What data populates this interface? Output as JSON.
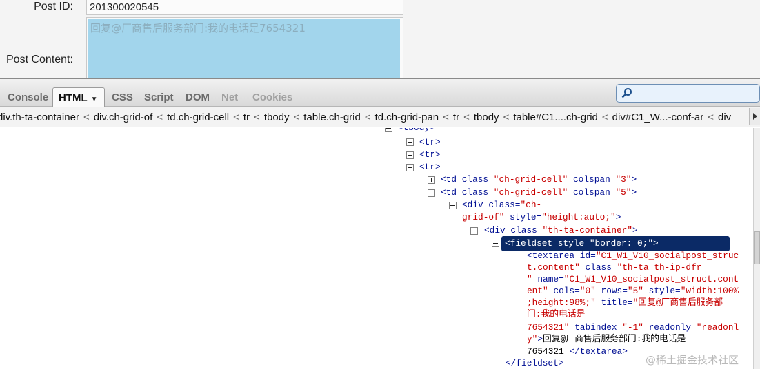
{
  "form": {
    "post_id_label": "Post ID:",
    "post_id_value": "201300020545",
    "post_content_label": "Post Content:",
    "post_content_value": "回复@厂商售后服务部门:我的电话是7654321"
  },
  "toolbar": {
    "tabs": [
      "Console",
      "HTML",
      "CSS",
      "Script",
      "DOM",
      "Net",
      "Cookies"
    ],
    "active_tab": "HTML",
    "search_value": ""
  },
  "breadcrumb": [
    "div.th-ta-container",
    "div.ch-grid-of",
    "td.ch-grid-cell",
    "tr",
    "tbody",
    "table.ch-grid",
    "td.ch-grid-pan",
    "tr",
    "tbody",
    "table#C1....ch-grid",
    "div#C1_W...-conf-ar",
    "div"
  ],
  "breadcrumb_sep": "<",
  "tree": {
    "tbody": "<tbody>",
    "tr1": "<tr>",
    "tr2": "<tr>",
    "tr3": "<tr>",
    "td1": {
      "open": "<td ",
      "a1": "class=",
      "v1": "\"ch-grid-cell\"",
      "a2": " colspan=",
      "v2": "\"3\"",
      "close": ">"
    },
    "td2": {
      "open": "<td ",
      "a1": "class=",
      "v1": "\"ch-grid-cell\"",
      "a2": " colspan=",
      "v2": "\"5\"",
      "close": ">"
    },
    "div1_l1": {
      "open": "<div ",
      "a1": "class=",
      "v1": "\"ch-"
    },
    "div1_l2": {
      "v1": "grid-of\"",
      "a2": " style=",
      "v2": "\"height:auto;\"",
      "close": ">"
    },
    "div2": {
      "open": "<div ",
      "a1": "class=",
      "v1": "\"th-ta-container\"",
      "close": ">"
    },
    "fieldset": "<fieldset style=\"border: 0;\">",
    "ta_l1": {
      "open": "<textarea ",
      "a1": "id=",
      "v1": "\"C1_W1_V10_socialpost_struc"
    },
    "ta_l2": {
      "v1": "t.content\"",
      "a2": " class=",
      "v2": "\"th-ta th-ip-dfr"
    },
    "ta_l3": {
      "v1": "\"",
      "a3": " name=",
      "v3": "\"C1_W1_V10_socialpost_struct.cont"
    },
    "ta_l4": {
      "v3": "ent\"",
      "a4": " cols=",
      "v4": "\"0\"",
      "a5": " rows=",
      "v5": "\"5\"",
      "a6": " style=",
      "v6": "\"width:100%"
    },
    "ta_l5": {
      "v6": ";height:98%;\"",
      "a7": " title=",
      "v7": "\"回复@厂商售后服务部"
    },
    "ta_l6": {
      "v7": "门:我的电话是"
    },
    "ta_l7": {
      "v7": "7654321\"",
      "a8": " tabindex=",
      "v8": "\"-1\"",
      "a9": " readonly=",
      "v9": "\"readonl"
    },
    "ta_l8": {
      "v9": "y\"",
      "close": ">",
      "text": "回复@厂商售后服务部门:我的电话是"
    },
    "ta_l9": {
      "text": "7654321",
      "endtag": "</textarea>"
    },
    "fieldset_end": "</fieldset>"
  },
  "watermark": "@稀土掘金技术社区"
}
